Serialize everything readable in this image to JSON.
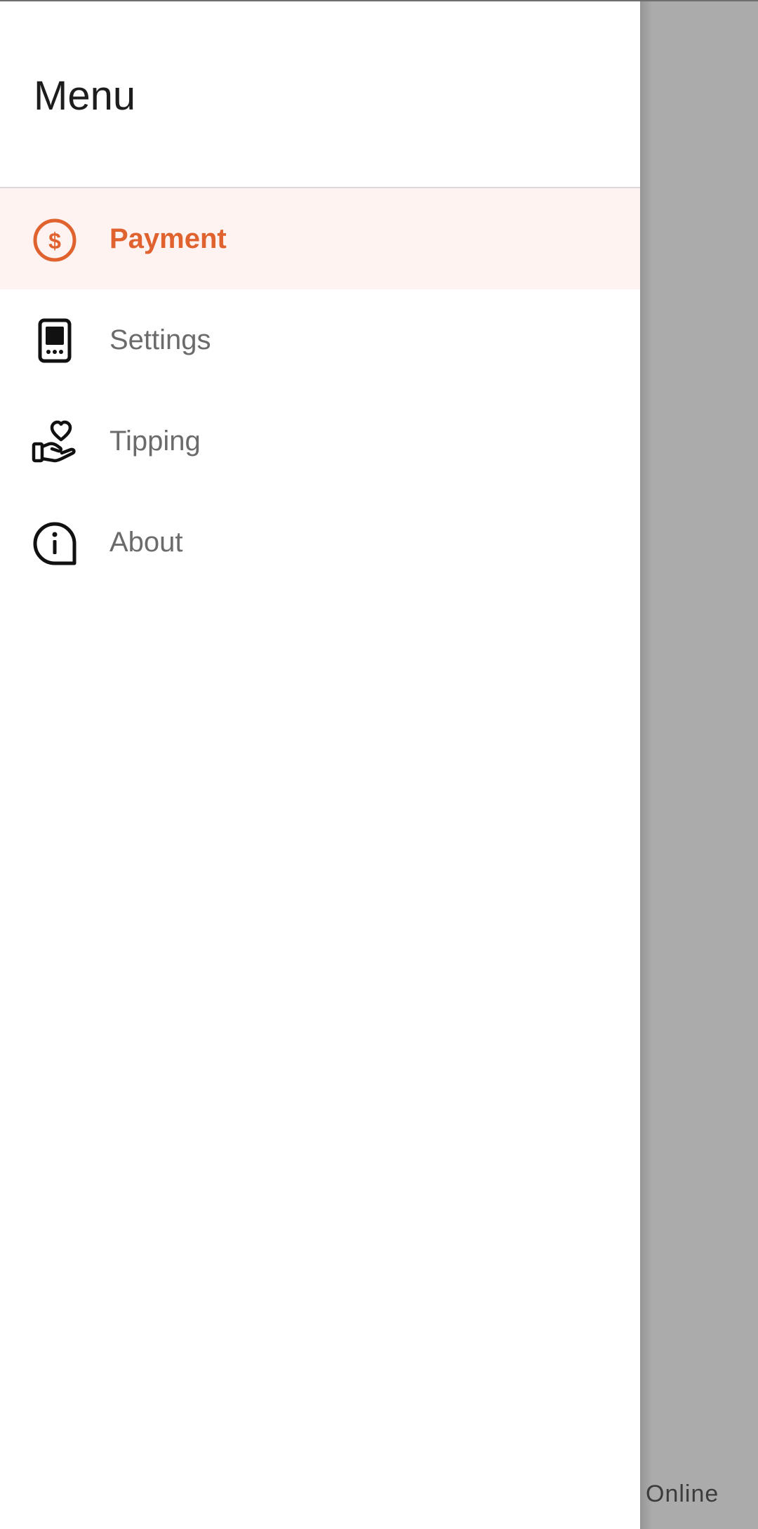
{
  "drawer": {
    "title": "Menu",
    "items": [
      {
        "label": "Payment",
        "icon": "dollar-circle-icon",
        "active": true
      },
      {
        "label": "Settings",
        "icon": "device-icon",
        "active": false
      },
      {
        "label": "Tipping",
        "icon": "hand-heart-icon",
        "active": false
      },
      {
        "label": "About",
        "icon": "info-icon",
        "active": false
      }
    ]
  },
  "background": {
    "status_text": "Online"
  },
  "colors": {
    "accent": "#e0622f",
    "active_item_bg": "#fff3f1",
    "scrim": "#ababab"
  }
}
